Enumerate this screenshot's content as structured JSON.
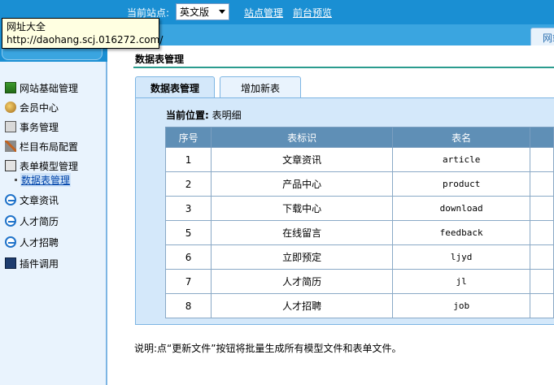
{
  "topbar": {
    "site_label": "当前站点:",
    "site_select_value": "英文版",
    "links": [
      "站点管理",
      "前台预览"
    ],
    "right_tab": "网站"
  },
  "tooltip": {
    "line1": "网址大全",
    "line2": "http://daohang.scj.016272.com/"
  },
  "sidebar": {
    "items": [
      {
        "label": "网站基础管理",
        "icon": "site-icon"
      },
      {
        "label": "会员中心",
        "icon": "member-icon"
      },
      {
        "label": "事务管理",
        "icon": "task-icon"
      },
      {
        "label": "栏目布局配置",
        "icon": "tools-icon"
      },
      {
        "label": "表单模型管理",
        "icon": "form-icon"
      }
    ],
    "sub_item": "数据表管理",
    "items2": [
      {
        "label": "文章资讯",
        "icon": "ie-icon"
      },
      {
        "label": "人才简历",
        "icon": "ie-icon"
      },
      {
        "label": "人才招聘",
        "icon": "ie-icon"
      },
      {
        "label": "插件调用",
        "icon": "plugin-icon"
      }
    ]
  },
  "main": {
    "title": "数据表管理",
    "tabs": [
      "数据表管理",
      "增加新表"
    ],
    "crumb_label": "当前位置:",
    "crumb_value": "表明细",
    "table": {
      "headers": [
        "序号",
        "表标识",
        "表名"
      ],
      "rows": [
        [
          "1",
          "文章资讯",
          "article"
        ],
        [
          "2",
          "产品中心",
          "product"
        ],
        [
          "3",
          "下载中心",
          "download"
        ],
        [
          "5",
          "在线留言",
          "feedback"
        ],
        [
          "6",
          "立即预定",
          "ljyd"
        ],
        [
          "7",
          "人才简历",
          "jl"
        ],
        [
          "8",
          "人才招聘",
          "job"
        ]
      ]
    },
    "note": "说明:点“更新文件”按钮将批量生成所有模型文件和表单文件。"
  }
}
